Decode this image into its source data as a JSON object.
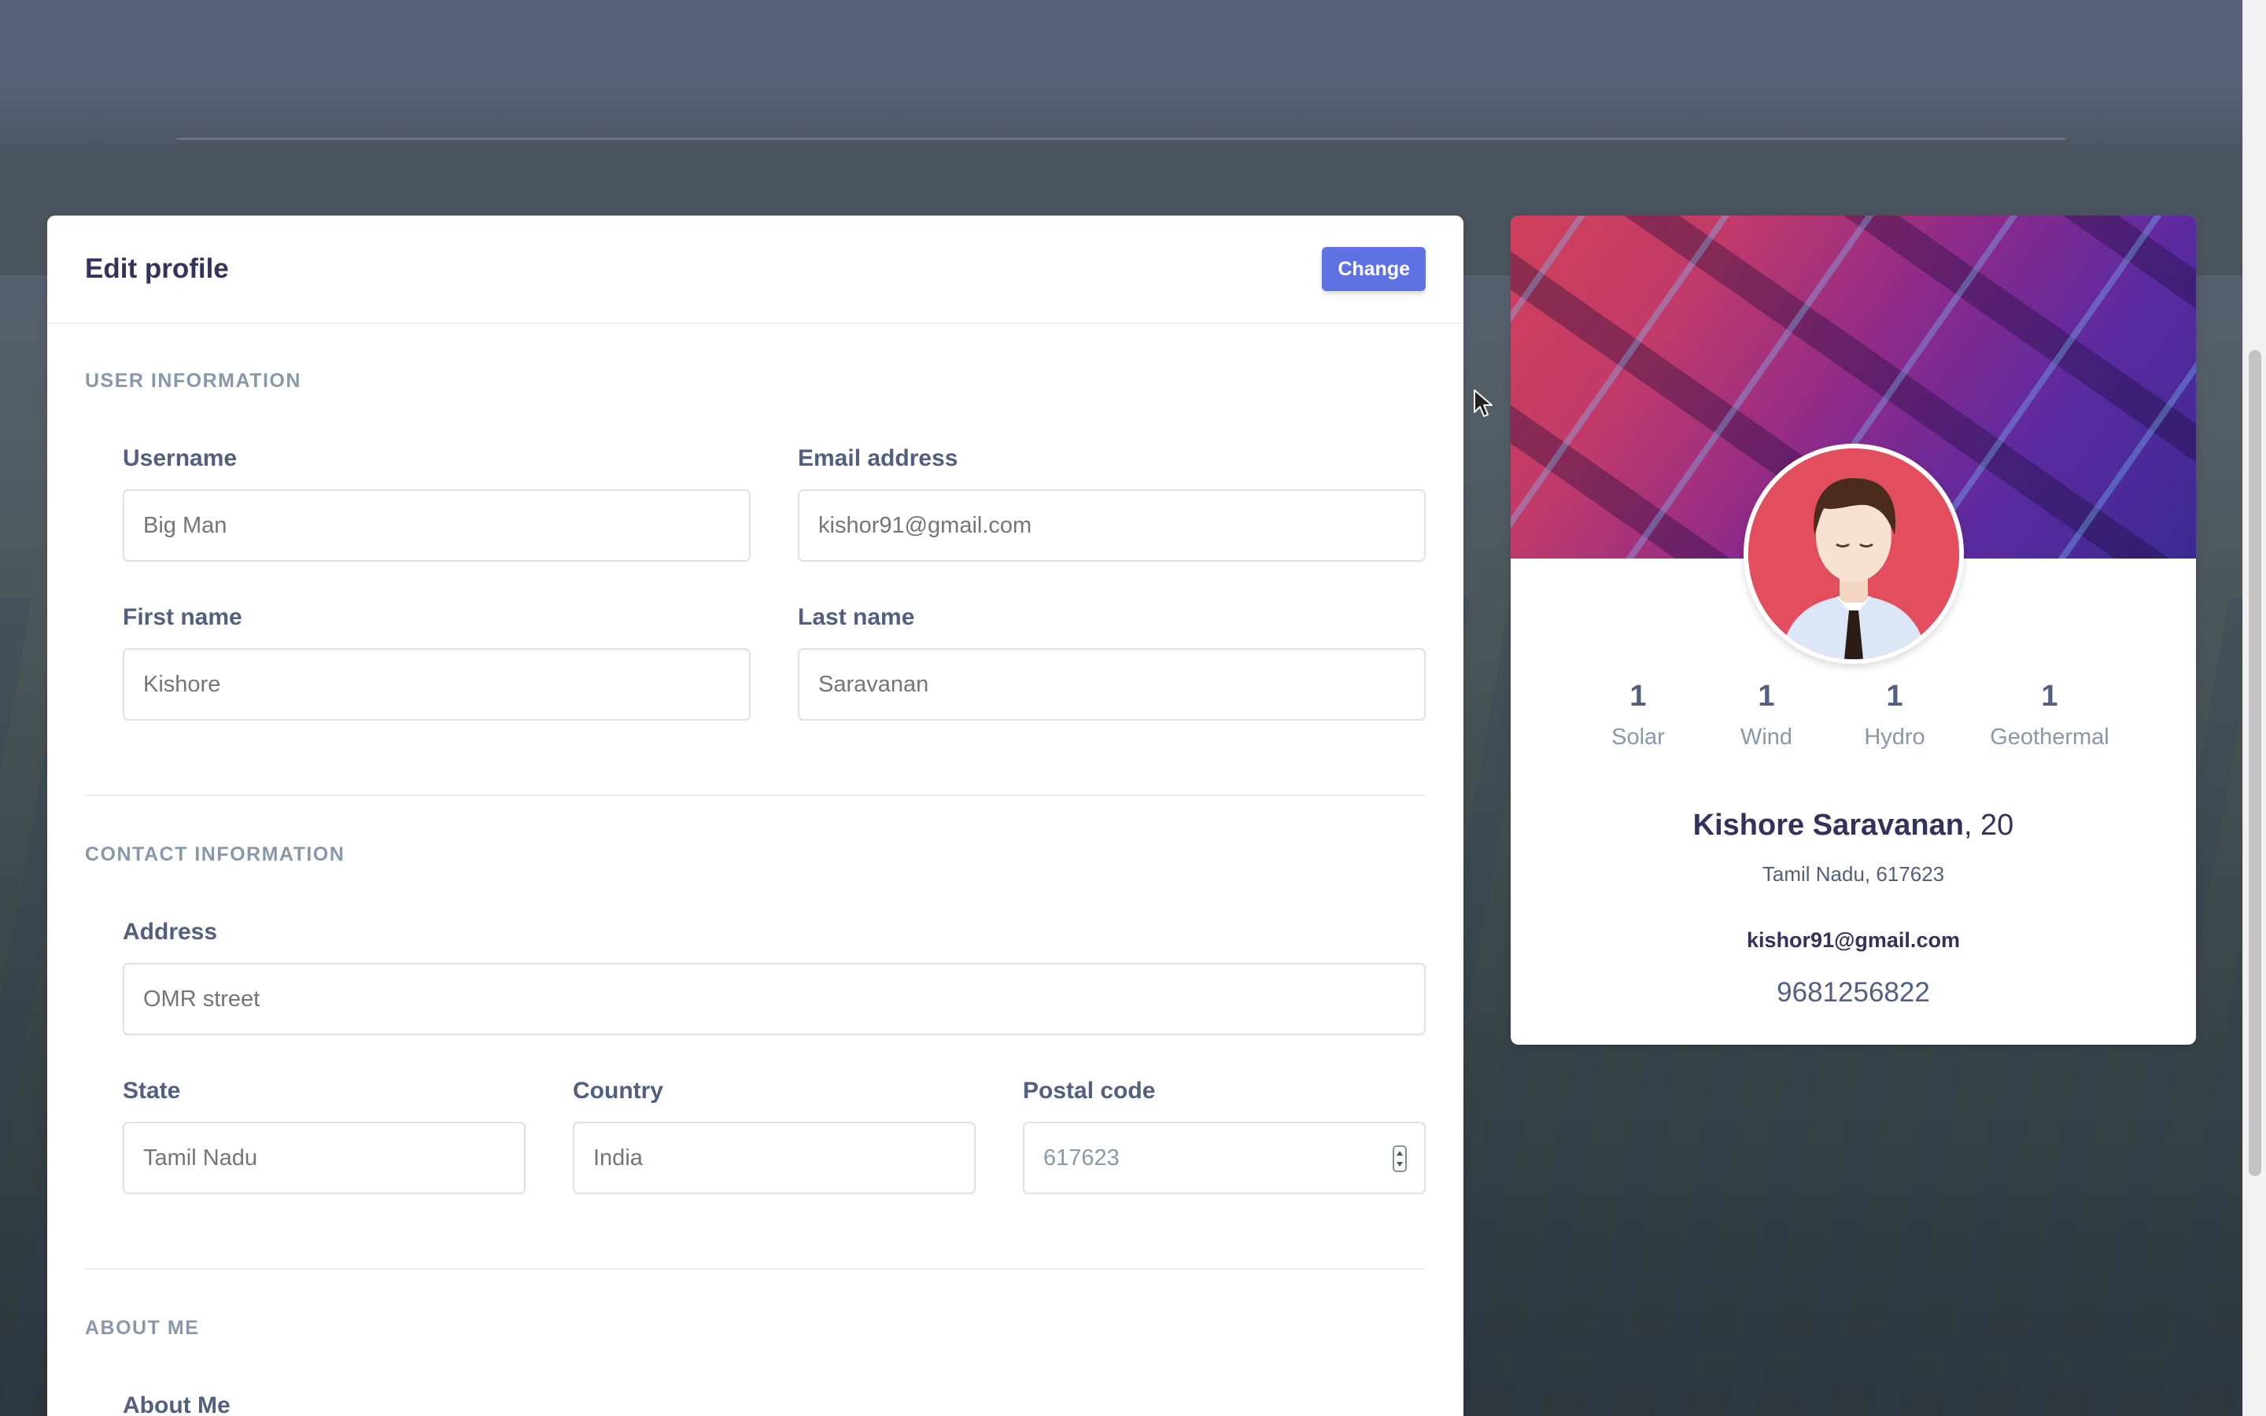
{
  "edit_profile": {
    "title": "Edit profile",
    "change_button": "Change",
    "user_information": {
      "heading": "User information",
      "username": {
        "label": "Username",
        "placeholder": "Big Man"
      },
      "email": {
        "label": "Email address",
        "placeholder": "kishor91@gmail.com"
      },
      "first_name": {
        "label": "First name",
        "placeholder": "Kishore"
      },
      "last_name": {
        "label": "Last name",
        "placeholder": "Saravanan"
      }
    },
    "contact_information": {
      "heading": "Contact information",
      "address": {
        "label": "Address",
        "placeholder": "OMR street"
      },
      "state": {
        "label": "State",
        "placeholder": "Tamil Nadu"
      },
      "country": {
        "label": "Country",
        "placeholder": "India"
      },
      "postal_code": {
        "label": "Postal code",
        "placeholder": "617623"
      }
    },
    "about_me": {
      "heading": "About me",
      "label": "About Me"
    }
  },
  "profile_card": {
    "stats": [
      {
        "value": "1",
        "label": "Solar"
      },
      {
        "value": "1",
        "label": "Wind"
      },
      {
        "value": "1",
        "label": "Hydro"
      },
      {
        "value": "1",
        "label": "Geothermal"
      }
    ],
    "name": "Kishore Saravanan",
    "age": ", 20",
    "location": "Tamil Nadu, 617623",
    "email": "kishor91@gmail.com",
    "phone": "9681256822"
  },
  "colors": {
    "accent": "#5e72e4",
    "heading_text": "#32325d",
    "body_text": "#525f7f",
    "muted_text": "#8898aa"
  }
}
